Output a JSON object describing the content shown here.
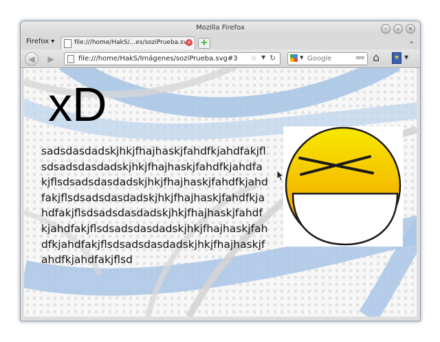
{
  "window": {
    "title": "Mozilla Firefox"
  },
  "menu": {
    "firefox_button": "Firefox ▾"
  },
  "tabs": [
    {
      "label": "file:///home/HakS/...es/soziPrueba.svg"
    }
  ],
  "tab_close_glyph": "×",
  "new_tab_glyph": "+",
  "tab_list_glyph": "⌄",
  "nav": {
    "back_glyph": "◀",
    "forward_glyph": "▶",
    "url": "file:///home/HakS/Imágenes/soziPrueba.svg#3",
    "star_glyph": "☆",
    "dropdown_glyph": "▼",
    "reload_glyph": "↻",
    "search_engine_dropdown": "▼",
    "search_placeholder": "Google",
    "search_go_glyph": "👓",
    "home_glyph": "⌂",
    "bookmarks_glyph": "★",
    "bookmarks_dropdown": "▼"
  },
  "window_buttons": {
    "minimize": "–",
    "maximize": "⌄",
    "close": "×"
  },
  "page": {
    "heading": "xD",
    "body_text": "sadsdasdadskjhkjfhajhaskjfahdfkjahdfakjflsdsadsdasdadskjhkjfhajhaskjfahdfkjahdfakjflsdsadsdasdadskjhkjfhajhaskjfahdfkjahdfakjflsdsadsdasdadskjhkjfhajhaskjfahdfkjahdfakjflsdsadsdasdadskjhkjfhajhaskjfahdfkjahdfakjflsdsadsdasdadskjhkjfhajhaskjfahdfkjahdfakjflsdsadsdasdadskjhkjfhajhaskjfahdfkjahdfakjflsd"
  },
  "colors": {
    "smiley_top": "#f7e800",
    "smiley_bottom": "#f08a00",
    "background_arc": "#aac6e6"
  }
}
